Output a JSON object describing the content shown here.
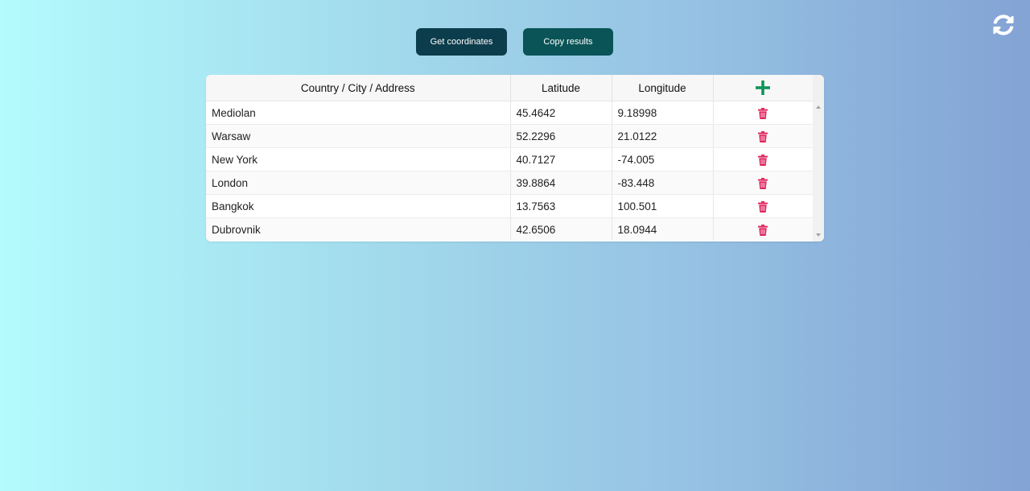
{
  "toolbar": {
    "get_coordinates_label": "Get coordinates",
    "copy_results_label": "Copy results"
  },
  "table": {
    "headers": {
      "location": "Country / City / Address",
      "latitude": "Latitude",
      "longitude": "Longitude"
    },
    "rows": [
      {
        "location": "Mediolan",
        "latitude": "45.4642",
        "longitude": "9.18998"
      },
      {
        "location": "Warsaw",
        "latitude": "52.2296",
        "longitude": "21.0122"
      },
      {
        "location": "New York",
        "latitude": "40.7127",
        "longitude": "-74.005"
      },
      {
        "location": "London",
        "latitude": "39.8864",
        "longitude": "-83.448"
      },
      {
        "location": "Bangkok",
        "latitude": "13.7563",
        "longitude": "100.501"
      },
      {
        "location": "Dubrovnik",
        "latitude": "42.6506",
        "longitude": "18.0944"
      }
    ]
  },
  "icons": {
    "refresh": "refresh-icon",
    "add": "plus-icon",
    "delete": "trash-icon"
  },
  "colors": {
    "get_button": "#0c3d4c",
    "copy_button": "#0a5457",
    "add_icon": "#0f9457",
    "delete_icon": "#e0245e"
  }
}
